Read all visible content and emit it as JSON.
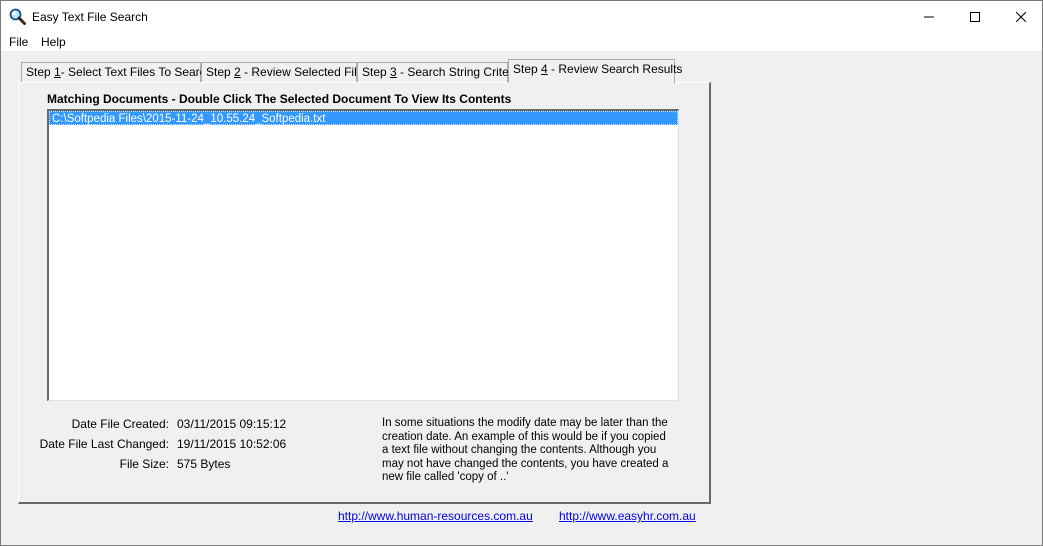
{
  "window": {
    "title": "Easy Text File Search",
    "icon": "magnifier-icon",
    "controls": {
      "minimize": "—",
      "maximize": "☐",
      "close": "✕"
    }
  },
  "menu": {
    "file": "File",
    "help": "Help"
  },
  "tabs": [
    {
      "prefix": "Step ",
      "num": "1",
      "rest": "- Select Text Files To Search"
    },
    {
      "prefix": "Step ",
      "num": "2",
      "rest": " - Review Selected Files"
    },
    {
      "prefix": "Step ",
      "num": "3",
      "rest": " - Search String Criteria"
    },
    {
      "prefix": "Step ",
      "num": "4",
      "rest": " - Review Search Results",
      "active": true
    }
  ],
  "results": {
    "heading": "Matching Documents - Double Click The Selected Document To View Its Contents",
    "items": [
      "C:\\Softpedia Files\\2015-11-24_10.55.24_Softpedia.txt"
    ],
    "selected_index": 0
  },
  "file_info": {
    "created_label": "Date File Created:",
    "created_value": "03/11/2015 09:15:12",
    "changed_label": "Date File Last Changed:",
    "changed_value": "19/11/2015 10:52:06",
    "size_label": "File Size:",
    "size_value": "575 Bytes"
  },
  "note": "In some situations the modify date may be later than the creation date.  An example of this would be if you copied a text file without changing the contents.  Although you may not have changed the contents, you have created a new file called 'copy of ..'",
  "links": {
    "hr": "http://www.human-resources.com.au",
    "easyhr": "http://www.easyhr.com.au"
  },
  "colors": {
    "selection": "#3399ff",
    "link": "#0000ee"
  }
}
